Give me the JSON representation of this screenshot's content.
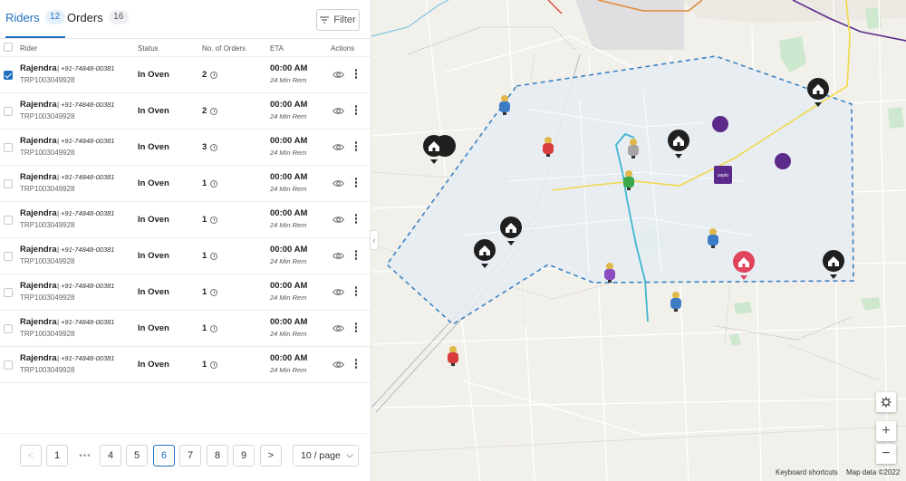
{
  "tabs": [
    {
      "label": "Riders",
      "count": "12"
    },
    {
      "label": "Orders",
      "count": "16"
    }
  ],
  "filter_label": "Filter",
  "columns": [
    "Rider",
    "Status",
    "No. of Orders",
    "ETA",
    "Actions"
  ],
  "riders": [
    {
      "name": "Rajendra",
      "phone": "| +91-74848-00381",
      "trip": "TRP1003049928",
      "status": "In Oven",
      "orders": "2",
      "eta": "00:00 AM",
      "remaining": "24 Min Rem",
      "checked": true
    },
    {
      "name": "Rajendra",
      "phone": "| +91-74848-00381",
      "trip": "TRP1003049928",
      "status": "In Oven",
      "orders": "2",
      "eta": "00:00 AM",
      "remaining": "24 Min Rem",
      "checked": false
    },
    {
      "name": "Rajendra",
      "phone": "| +91-74848-00381",
      "trip": "TRP1003049928",
      "status": "In Oven",
      "orders": "3",
      "eta": "00:00 AM",
      "remaining": "24 Min Rem",
      "checked": false
    },
    {
      "name": "Rajendra",
      "phone": "| +91-74848-00381",
      "trip": "TRP1003049928",
      "status": "In Oven",
      "orders": "1",
      "eta": "00:00 AM",
      "remaining": "24 Min Rem",
      "checked": false
    },
    {
      "name": "Rajendra",
      "phone": "| +91-74848-00381",
      "trip": "TRP1003049928",
      "status": "In Oven",
      "orders": "1",
      "eta": "00:00 AM",
      "remaining": "24 Min Rem",
      "checked": false
    },
    {
      "name": "Rajendra",
      "phone": "| +91-74848-00381",
      "trip": "TRP1003049928",
      "status": "In Oven",
      "orders": "1",
      "eta": "00:00 AM",
      "remaining": "24 Min Rem",
      "checked": false
    },
    {
      "name": "Rajendra",
      "phone": "| +91-74848-00381",
      "trip": "TRP1003049928",
      "status": "In Oven",
      "orders": "1",
      "eta": "00:00 AM",
      "remaining": "24 Min Rem",
      "checked": false
    },
    {
      "name": "Rajendra",
      "phone": "| +91-74848-00381",
      "trip": "TRP1003049928",
      "status": "In Oven",
      "orders": "1",
      "eta": "00:00 AM",
      "remaining": "24 Min Rem",
      "checked": false
    },
    {
      "name": "Rajendra",
      "phone": "| +91-74848-00381",
      "trip": "TRP1003049928",
      "status": "In Oven",
      "orders": "1",
      "eta": "00:00 AM",
      "remaining": "24 Min Rem",
      "checked": false
    }
  ],
  "pagination": {
    "prev": "<",
    "next": ">",
    "ellipsis": "•••",
    "pages": [
      "1",
      "4",
      "5",
      "6",
      "7",
      "8",
      "9"
    ],
    "current": "6",
    "page_size": "10 / page"
  },
  "map": {
    "keyboard_shortcuts": "Keyboard shortcuts",
    "map_data": "Map data ©2022",
    "zoom_in": "+",
    "zoom_out": "−",
    "store_label": "zepto",
    "colors": {
      "zone_border": "#3b82c4",
      "zone_fill": "#e6ecf3",
      "store_purple": "#5b2a8a",
      "home_pin": "#1f1f1f",
      "home_pin_active": "#e0445a",
      "route_cyan": "#3fb6cf",
      "highway_yellow": "#f2d84a",
      "park_green": "#cde8cf"
    }
  }
}
